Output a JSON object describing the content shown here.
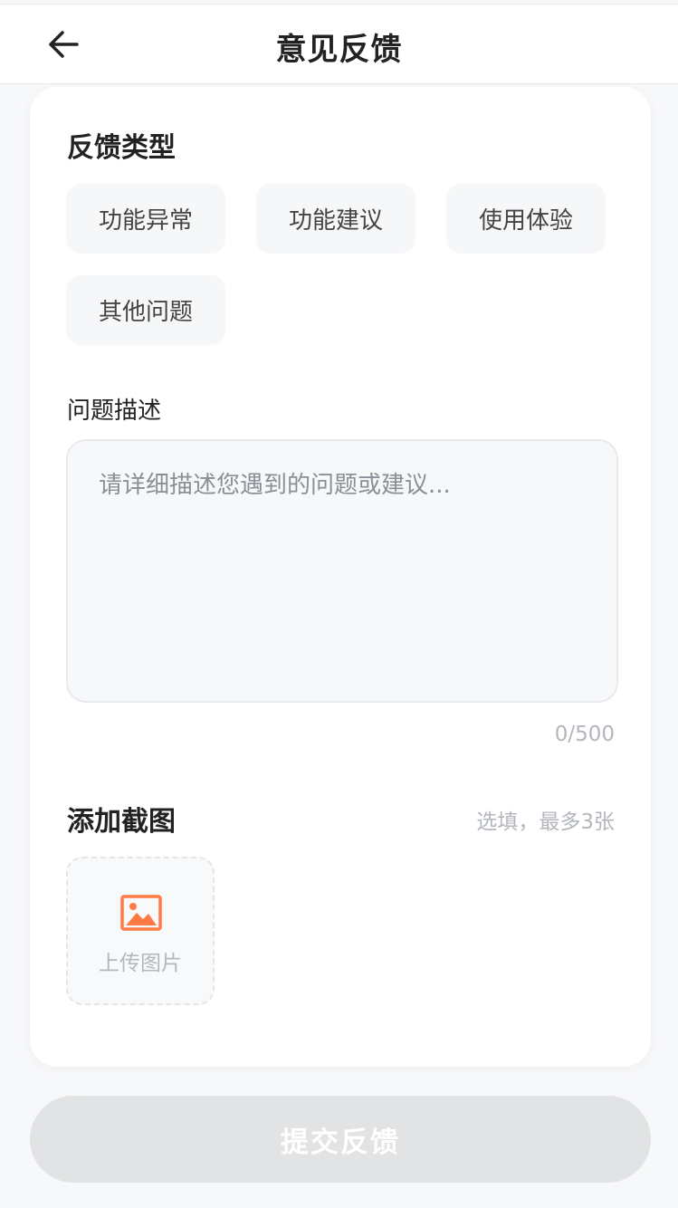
{
  "header": {
    "title": "意见反馈",
    "back_icon": "arrow-left-icon"
  },
  "feedback_type": {
    "title": "反馈类型",
    "options": [
      "功能异常",
      "功能建议",
      "使用体验",
      "其他问题"
    ]
  },
  "description": {
    "label": "问题描述",
    "placeholder": "请详细描述您遇到的问题或建议...",
    "value": "",
    "counter": "0/500"
  },
  "screenshots": {
    "title": "添加截图",
    "hint": "选填，最多3张",
    "upload_label": "上传图片",
    "upload_icon": "image-icon"
  },
  "submit": {
    "label": "提交反馈"
  },
  "colors": {
    "accent": "#ff7a45",
    "submit_disabled": "#e2e3e4",
    "background": "#f7f8fa"
  }
}
